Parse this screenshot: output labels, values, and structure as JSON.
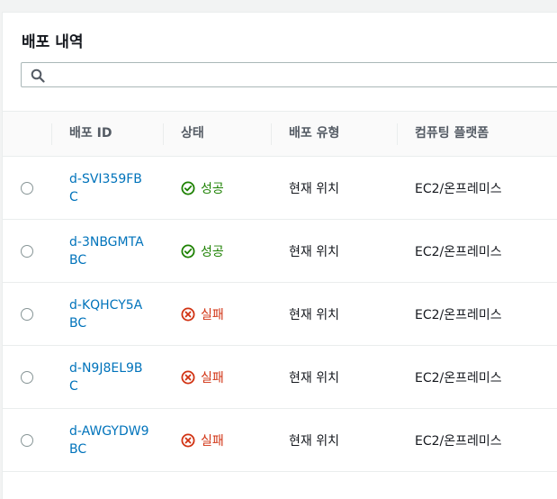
{
  "page": {
    "title": "배포 내역"
  },
  "search": {
    "value": "",
    "placeholder": ""
  },
  "columns": {
    "deployment_id": "배포 ID",
    "status": "상태",
    "deployment_type": "배포 유형",
    "compute_platform": "컴퓨팅 플랫폼"
  },
  "rows": [
    {
      "id": "d-SVI359FBC",
      "status": "성공",
      "status_kind": "success",
      "type": "현재 위치",
      "platform": "EC2/온프레미스"
    },
    {
      "id": "d-3NBGMTABC",
      "status": "성공",
      "status_kind": "success",
      "type": "현재 위치",
      "platform": "EC2/온프레미스"
    },
    {
      "id": "d-KQHCY5ABC",
      "status": "실패",
      "status_kind": "failed",
      "type": "현재 위치",
      "platform": "EC2/온프레미스"
    },
    {
      "id": "d-N9J8EL9BC",
      "status": "실패",
      "status_kind": "failed",
      "type": "현재 위치",
      "platform": "EC2/온프레미스"
    },
    {
      "id": "d-AWGYDW9BC",
      "status": "실패",
      "status_kind": "failed",
      "type": "현재 위치",
      "platform": "EC2/온프레미스"
    }
  ],
  "icons": {
    "search": "search-icon",
    "success": "check-circle-icon",
    "failed": "x-circle-icon"
  },
  "colors": {
    "link": "#0073bb",
    "success": "#1d8102",
    "failed": "#d13212"
  }
}
